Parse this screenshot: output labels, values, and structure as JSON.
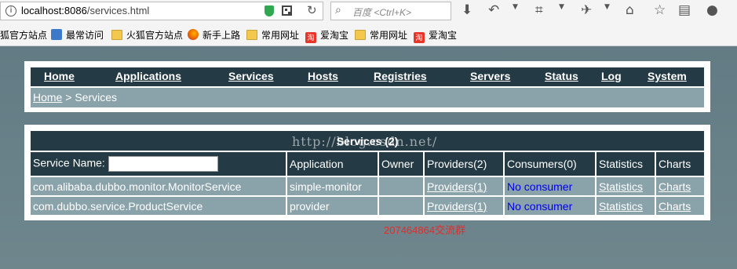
{
  "browser": {
    "url_host": "localhost:8086",
    "url_path": "/services.html",
    "search_placeholder": "百度 <Ctrl+K>"
  },
  "bookmarks": [
    {
      "label": "狐官方站点",
      "icon": "folder-icon"
    },
    {
      "label": "最常访问",
      "icon": "search-icon"
    },
    {
      "label": "火狐官方站点",
      "icon": "folder-icon"
    },
    {
      "label": "新手上路",
      "icon": "firefox-icon"
    },
    {
      "label": "常用网址",
      "icon": "folder-icon"
    },
    {
      "label": "爱淘宝",
      "icon": "taobao-icon"
    },
    {
      "label": "常用网址",
      "icon": "folder-icon"
    },
    {
      "label": "爱淘宝",
      "icon": "taobao-icon"
    }
  ],
  "nav": {
    "items": [
      "Home",
      "Applications",
      "Services",
      "Hosts",
      "Registries",
      "Servers",
      "Status",
      "Log",
      "System"
    ]
  },
  "breadcrumb": {
    "home": "Home",
    "separator": " > ",
    "current": "Services"
  },
  "services": {
    "caption": "Services (2)",
    "filter_label": "Service Name:",
    "filter_value": "",
    "columns": [
      "Application",
      "Owner",
      "Providers(2)",
      "Consumers(0)",
      "Statistics",
      "Charts"
    ],
    "rows": [
      {
        "service": "com.alibaba.dubbo.monitor.MonitorService",
        "application": "simple-monitor",
        "owner": "",
        "providers": "Providers(1)",
        "consumers": "No consumer",
        "statistics": "Statistics",
        "charts": "Charts"
      },
      {
        "service": "com.dubbo.service.ProductService",
        "application": "provider",
        "owner": "",
        "providers": "Providers(1)",
        "consumers": "No consumer",
        "statistics": "Statistics",
        "charts": "Charts"
      }
    ]
  },
  "watermark": "http://blog.csdn.net/",
  "promo_text": "207464864交流群"
}
